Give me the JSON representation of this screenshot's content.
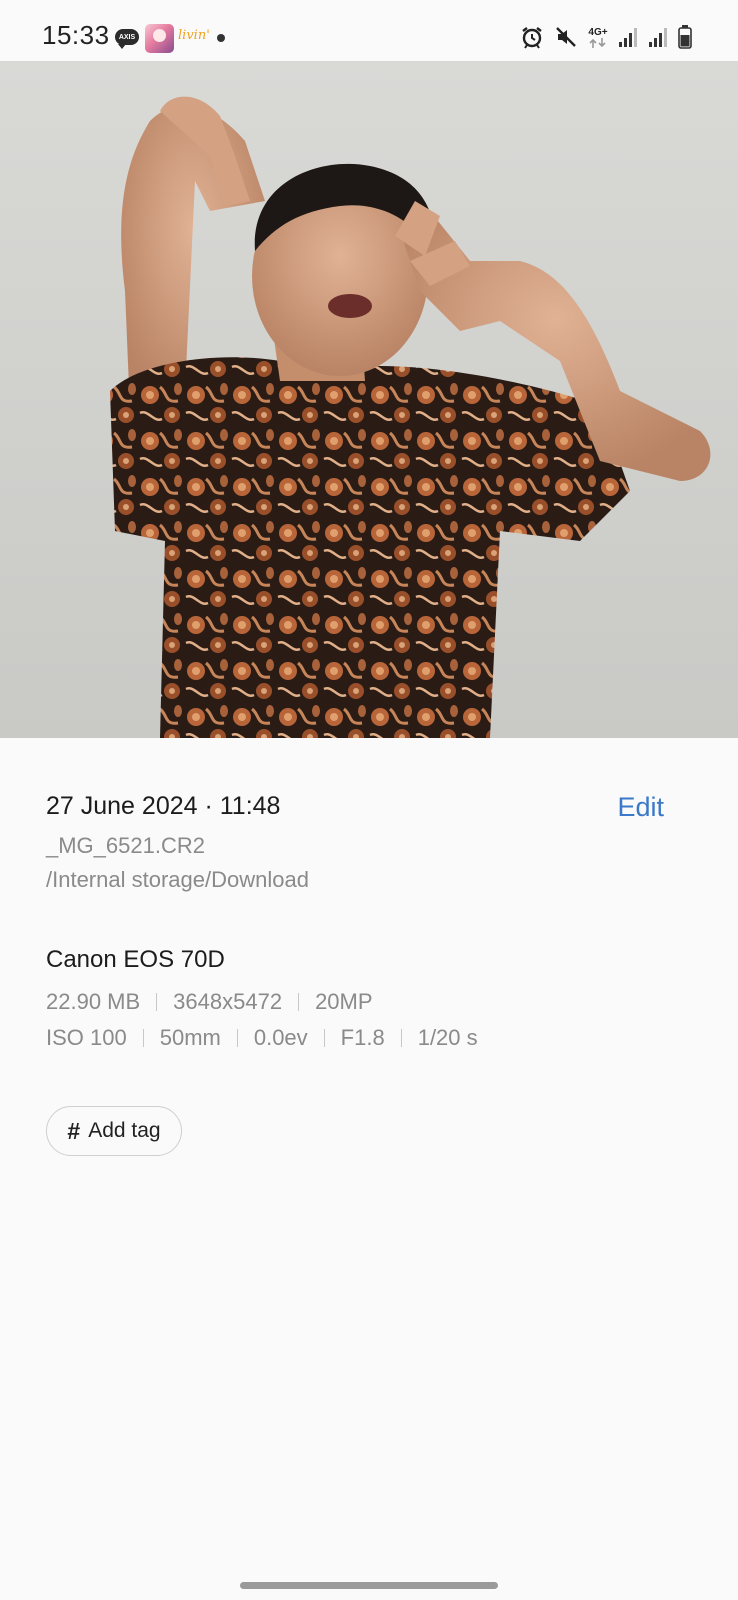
{
  "status_bar": {
    "time": "15:33",
    "axis_badge": "AXIS",
    "livin_label": "livin'",
    "network": "4G+",
    "icons": [
      "alarm-icon",
      "mute-icon",
      "signal-icon",
      "signal-icon",
      "battery-icon"
    ]
  },
  "photo": {
    "description_icon": "photo-preview"
  },
  "details": {
    "date_time": "27 June 2024 · 11:48",
    "edit_label": "Edit",
    "filename": "_MG_6521.CR2",
    "path": "/Internal storage/Download",
    "camera": "Canon EOS 70D",
    "file_info": [
      "22.90 MB",
      "3648x5472",
      "20MP"
    ],
    "exposure": [
      "ISO 100",
      "50mm",
      "0.0ev",
      "F1.8",
      "1/20 s"
    ]
  },
  "tag_button": {
    "icon": "#",
    "label": "Add tag"
  },
  "colors": {
    "accent": "#3a78c9",
    "background": "#fafafa",
    "secondary_text": "#8a8a8a"
  }
}
